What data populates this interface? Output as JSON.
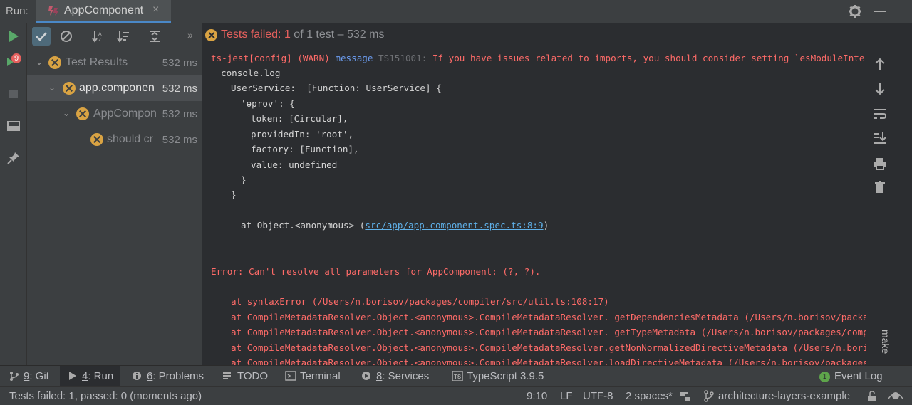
{
  "header": {
    "run_label": "Run:",
    "tab_title": "AppComponent",
    "tab_close": "×"
  },
  "left_strip": {
    "rerun_badge": "9"
  },
  "test_toolbar": {
    "more": "»"
  },
  "tree": {
    "rows": [
      {
        "label": "Test Results",
        "time": "532 ms"
      },
      {
        "label": "app.componen",
        "time": "532 ms"
      },
      {
        "label": "AppCompon",
        "time": "532 ms"
      },
      {
        "label": "should cr",
        "time": "532 ms"
      }
    ]
  },
  "status": {
    "failed_label": "Tests failed: ",
    "failed_count": "1",
    "rest": " of 1 test – 532 ms"
  },
  "console": {
    "line1_a": "ts-jest[config] (WARN) ",
    "line1_b": "message",
    "line1_c": " TS151001:",
    "line1_d": " If you have issues related to imports, you should consider setting `esModuleInterop` to",
    "line2": "console.log",
    "line3": "UserService:  [Function: UserService] {",
    "line4": "'ɵprov': {",
    "line5": "token: [Circular],",
    "line6": "providedIn: 'root',",
    "line7": "factory: [Function],",
    "line8": "value: undefined",
    "line9": "}",
    "line10": "}",
    "line11_a": "at Object.<anonymous> (",
    "line11_link": "src/app/app.component.spec.ts:8:9",
    "line11_b": ")",
    "error_line": "Error: Can't resolve all parameters for AppComponent: (?, ?).",
    "stack": [
      "at syntaxError (/Users/n.borisov/packages/compiler/src/util.ts:108:17)",
      "at CompileMetadataResolver.Object.<anonymous>.CompileMetadataResolver._getDependenciesMetadata (/Users/n.borisov/packages/com",
      "at CompileMetadataResolver.Object.<anonymous>.CompileMetadataResolver._getTypeMetadata (/Users/n.borisov/packages/compiler/sr",
      "at CompileMetadataResolver.Object.<anonymous>.CompileMetadataResolver.getNonNormalizedDirectiveMetadata (/Users/n.borisov/pac",
      "at CompileMetadataResolver.Object.<anonymous>.CompileMetadataResolver.loadDirectiveMetadata (/Users/n.borisov/packages/compil"
    ]
  },
  "right_strip": {
    "make_label": "make"
  },
  "tool_windows": {
    "git_num": "9",
    "git_label": ": Git",
    "run_num": "4",
    "run_label": ": Run",
    "problems_num": "6",
    "problems_label": ": Problems",
    "todo": "TODO",
    "terminal": "Terminal",
    "services_num": "8",
    "services_label": ": Services",
    "typescript": "TypeScript 3.9.5",
    "event_count": "1",
    "event_log": "Event Log"
  },
  "statusbar": {
    "message": "Tests failed: 1, passed: 0 (moments ago)",
    "position": "9:10",
    "line_sep": "LF",
    "encoding": "UTF-8",
    "indent": "2 spaces*",
    "branch": "architecture-layers-example"
  },
  "colors": {
    "accent": "#4a88c7",
    "fail_icon": "#d9a343",
    "error_text": "#ff6b68",
    "play_green": "#59a869"
  }
}
